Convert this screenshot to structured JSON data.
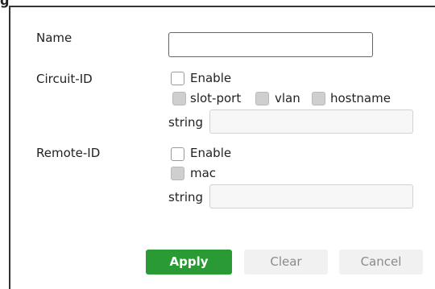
{
  "header": {
    "title_fragment": "g"
  },
  "form": {
    "name": {
      "label": "Name",
      "value": ""
    },
    "circuit_id": {
      "label": "Circuit-ID",
      "enable_label": "Enable",
      "enable_checked": false,
      "options": [
        "slot-port",
        "vlan",
        "hostname"
      ],
      "string_label": "string",
      "string_value": ""
    },
    "remote_id": {
      "label": "Remote-ID",
      "enable_label": "Enable",
      "enable_checked": false,
      "options": [
        "mac"
      ],
      "string_label": "string",
      "string_value": ""
    }
  },
  "buttons": {
    "apply": "Apply",
    "clear": "Clear",
    "cancel": "Cancel"
  },
  "colors": {
    "primary": "#2a9a34",
    "secondary_bg": "#f1f1f1",
    "secondary_text": "#8a8a8a"
  }
}
